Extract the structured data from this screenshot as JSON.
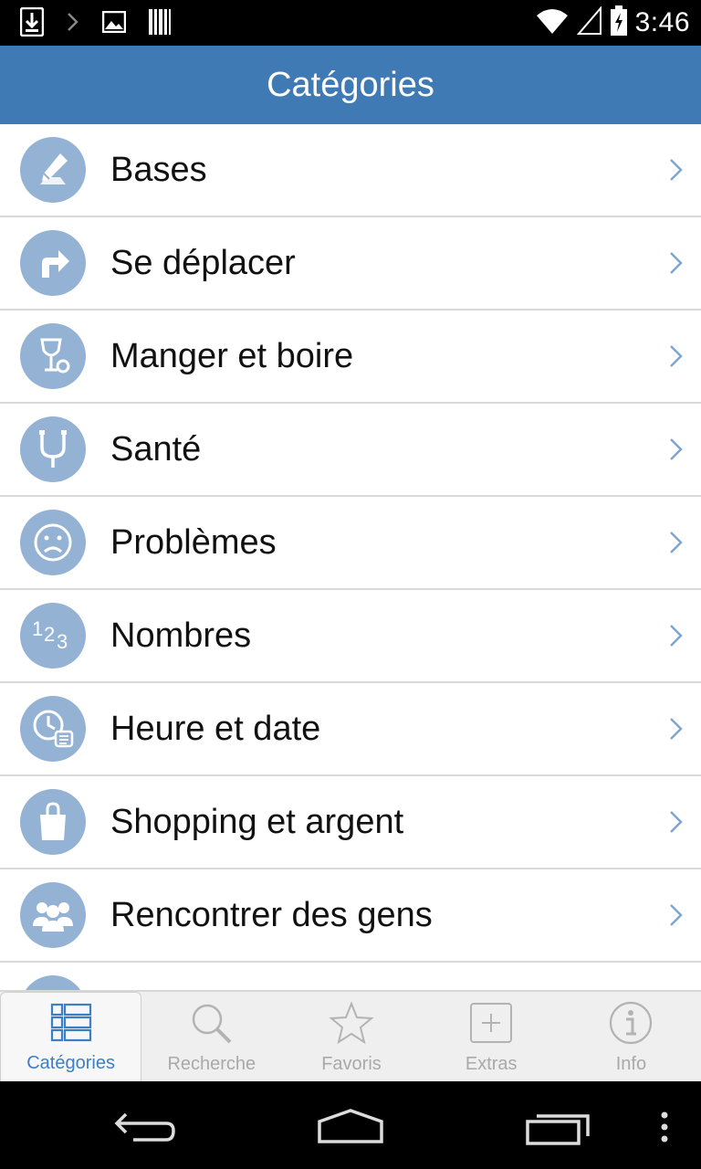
{
  "status_bar": {
    "time": "3:46",
    "icons": [
      "download-icon",
      "chevron-right-icon",
      "image-icon",
      "barcode-icon",
      "wifi-icon",
      "signal-icon",
      "battery-charging-icon"
    ]
  },
  "action_bar": {
    "title": "Catégories"
  },
  "categories": [
    {
      "label": "Bases",
      "icon": "pencil-icon"
    },
    {
      "label": "Se déplacer",
      "icon": "turn-right-arrow-icon"
    },
    {
      "label": "Manger et boire",
      "icon": "wine-glass-icon"
    },
    {
      "label": "Santé",
      "icon": "stethoscope-icon"
    },
    {
      "label": "Problèmes",
      "icon": "sad-face-icon"
    },
    {
      "label": "Nombres",
      "icon": "numbers-123-icon"
    },
    {
      "label": "Heure et date",
      "icon": "clock-calendar-icon"
    },
    {
      "label": "Shopping et argent",
      "icon": "shopping-bag-icon"
    },
    {
      "label": "Rencontrer des gens",
      "icon": "people-icon"
    }
  ],
  "tabs": [
    {
      "label": "Catégories",
      "icon": "list-grid-icon",
      "active": true
    },
    {
      "label": "Recherche",
      "icon": "search-icon",
      "active": false
    },
    {
      "label": "Favoris",
      "icon": "star-icon",
      "active": false
    },
    {
      "label": "Extras",
      "icon": "plus-box-icon",
      "active": false
    },
    {
      "label": "Info",
      "icon": "info-icon",
      "active": false
    }
  ],
  "colors": {
    "action_bar": "#3f7ab4",
    "icon_circle": "#93b2d4",
    "chevron": "#7fa6cf",
    "tab_active": "#3d7fc4",
    "tab_inactive": "#a9a9a9"
  }
}
